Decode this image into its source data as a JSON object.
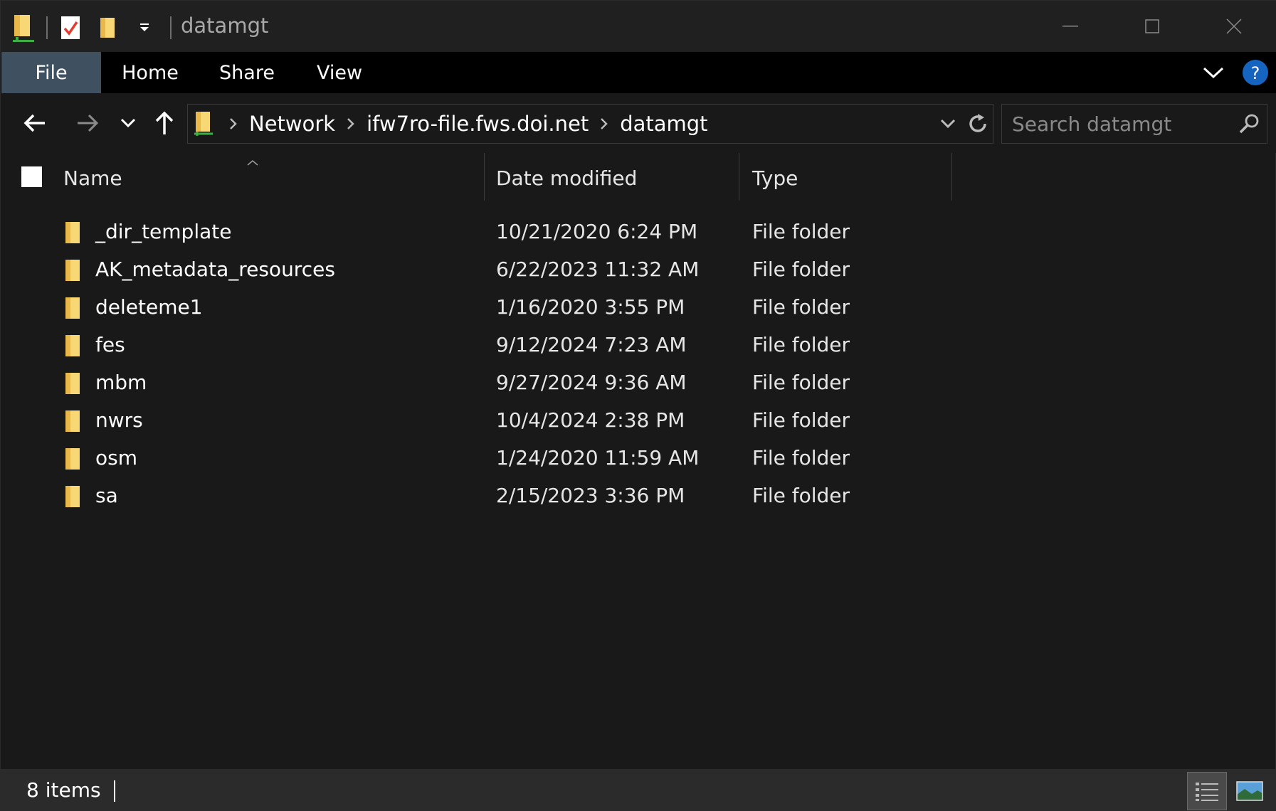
{
  "window": {
    "title": "datamgt",
    "minimize_icon": "minimize-icon",
    "maximize_icon": "maximize-icon",
    "close_icon": "close-icon"
  },
  "ribbon": {
    "tabs": [
      "File",
      "Home",
      "Share",
      "View"
    ],
    "file_tab_color": "#3f5161",
    "help_color": "#1565c0"
  },
  "address": {
    "crumbs": [
      "Network",
      "ifw7ro-file.fws.doi.net",
      "datamgt"
    ]
  },
  "search": {
    "placeholder": "Search datamgt"
  },
  "columns": {
    "name": "Name",
    "date": "Date modified",
    "type": "Type"
  },
  "files": [
    {
      "name": "_dir_template",
      "date": "10/21/2020 6:24 PM",
      "type": "File folder"
    },
    {
      "name": "AK_metadata_resources",
      "date": "6/22/2023 11:32 AM",
      "type": "File folder"
    },
    {
      "name": "deleteme1",
      "date": "1/16/2020 3:55 PM",
      "type": "File folder"
    },
    {
      "name": "fes",
      "date": "9/12/2024 7:23 AM",
      "type": "File folder"
    },
    {
      "name": "mbm",
      "date": "9/27/2024 9:36 AM",
      "type": "File folder"
    },
    {
      "name": "nwrs",
      "date": "10/4/2024 2:38 PM",
      "type": "File folder"
    },
    {
      "name": "osm",
      "date": "1/24/2020 11:59 AM",
      "type": "File folder"
    },
    {
      "name": "sa",
      "date": "2/15/2023 3:36 PM",
      "type": "File folder"
    }
  ],
  "status": {
    "items_text": "8 items"
  },
  "colors": {
    "folder": "#f8d775",
    "background": "#191919"
  }
}
